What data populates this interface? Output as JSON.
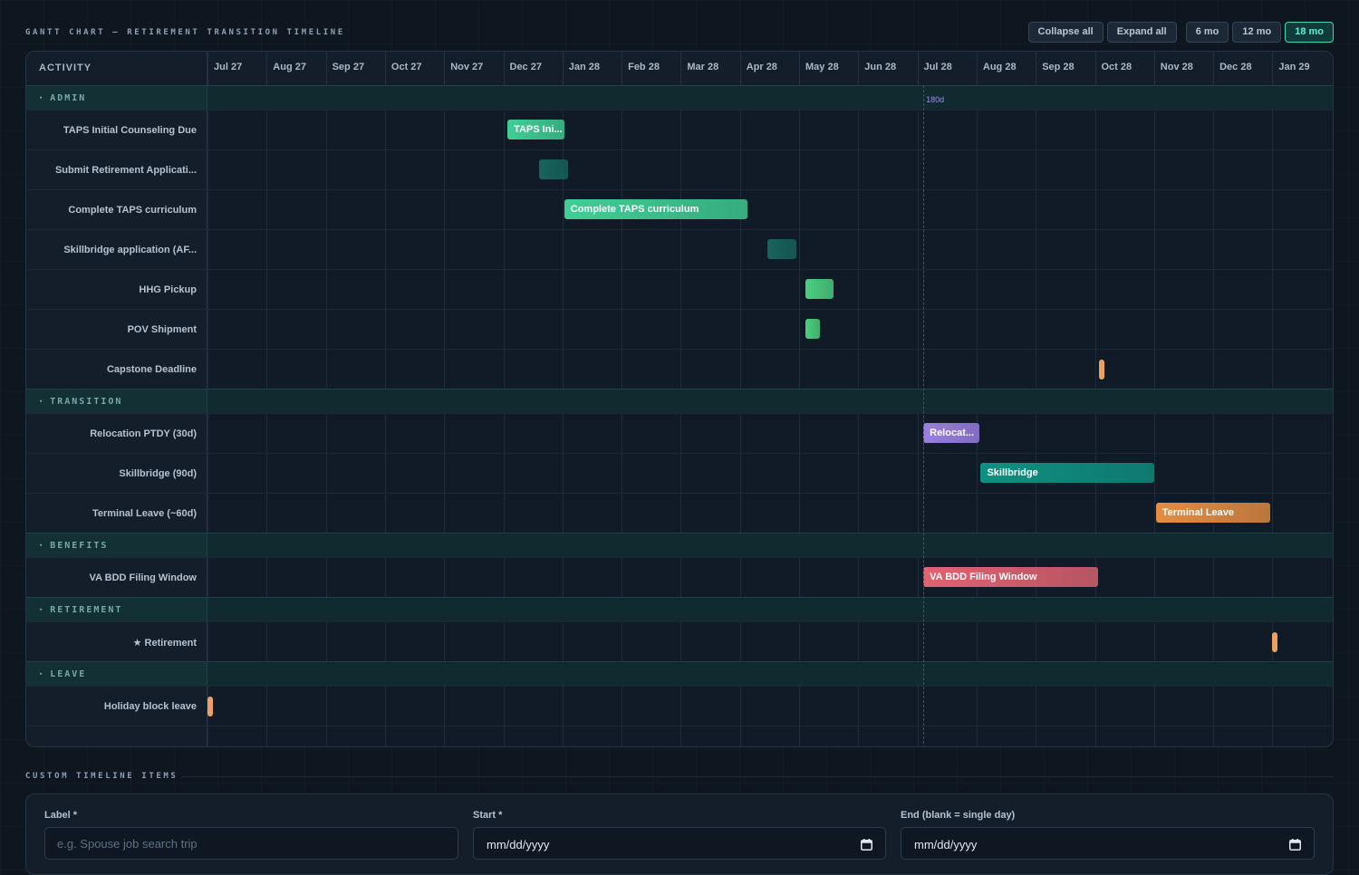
{
  "header": {
    "title": "GANTT CHART — RETIREMENT TRANSITION TIMELINE",
    "buttons": {
      "collapse_all": "Collapse all",
      "expand_all": "Expand all",
      "range_6": "6 mo",
      "range_12": "12 mo",
      "range_18": "18 mo"
    },
    "active_range": "18 mo"
  },
  "gantt": {
    "activity_header": "ACTIVITY",
    "months": [
      "Jul 27",
      "Aug 27",
      "Sep 27",
      "Oct 27",
      "Nov 27",
      "Dec 27",
      "Jan 28",
      "Feb 28",
      "Mar 28",
      "Apr 28",
      "May 28",
      "Jun 28",
      "Jul 28",
      "Aug 28",
      "Sep 28",
      "Oct 28",
      "Nov 28",
      "Dec 28",
      "Jan 29"
    ],
    "today_marker_label": "180d",
    "sections": [
      {
        "name": "ADMIN",
        "tasks": [
          {
            "label": "TAPS Initial Counseling Due",
            "bar_label": "TAPS Ini...",
            "start_month": 5.07,
            "end_month": 6.03,
            "color": "#3fcf95",
            "kind": "bar"
          },
          {
            "label": "Submit Retirement Applicati...",
            "bar_label": "",
            "start_month": 5.61,
            "end_month": 6.1,
            "color": "#17635c",
            "kind": "bar"
          },
          {
            "label": "Complete TAPS curriculum",
            "bar_label": "Complete TAPS curriculum",
            "start_month": 6.03,
            "end_month": 9.13,
            "color": "#3fcf95",
            "kind": "bar"
          },
          {
            "label": "Skillbridge application (AF...",
            "bar_label": "",
            "start_month": 9.47,
            "end_month": 9.95,
            "color": "#17635c",
            "kind": "bar"
          },
          {
            "label": "HHG Pickup",
            "bar_label": "",
            "start_month": 10.1,
            "end_month": 10.58,
            "color": "#4cd07f",
            "kind": "bar"
          },
          {
            "label": "POV Shipment",
            "bar_label": "",
            "start_month": 10.1,
            "end_month": 10.35,
            "color": "#4cd07f",
            "kind": "bar"
          },
          {
            "label": "Capstone Deadline",
            "bar_label": "",
            "start_month": 15.1,
            "end_month": 15.1,
            "color": "#eba25f",
            "kind": "milestone"
          }
        ]
      },
      {
        "name": "TRANSITION",
        "tasks": [
          {
            "label": "Relocation PTDY (30d)",
            "bar_label": "Relocat...",
            "start_month": 12.1,
            "end_month": 13.05,
            "color": "#9b80e4",
            "kind": "bar"
          },
          {
            "label": "Skillbridge (90d)",
            "bar_label": "Skillbridge",
            "start_month": 13.07,
            "end_month": 16.0,
            "color": "#0f9080",
            "kind": "bar"
          },
          {
            "label": "Terminal Leave (~60d)",
            "bar_label": "Terminal Leave",
            "start_month": 16.03,
            "end_month": 17.96,
            "color": "#e58d42",
            "kind": "bar"
          }
        ]
      },
      {
        "name": "BENEFITS",
        "tasks": [
          {
            "label": "VA BDD Filing Window",
            "bar_label": "VA BDD Filing Window",
            "start_month": 12.1,
            "end_month": 15.05,
            "color": "#e06371",
            "kind": "bar"
          }
        ]
      },
      {
        "name": "RETIREMENT",
        "tasks": [
          {
            "label": "★ Retirement",
            "bar_label": "",
            "start_month": 18.03,
            "end_month": 18.03,
            "color": "#eba25f",
            "kind": "milestone"
          }
        ]
      },
      {
        "name": "LEAVE",
        "tasks": [
          {
            "label": "Holiday block leave",
            "bar_label": "",
            "start_month": 0.03,
            "end_month": 0.03,
            "color": "#eba25f",
            "kind": "milestone"
          }
        ]
      }
    ],
    "today_month": 12.1
  },
  "custom": {
    "title": "CUSTOM TIMELINE ITEMS",
    "label_field": {
      "label": "Label *",
      "placeholder": "e.g. Spouse job search trip"
    },
    "start_field": {
      "label": "Start *",
      "value": "mm/dd/yyyy"
    },
    "end_field": {
      "label": "End (blank = single day)",
      "value": "mm/dd/yyyy"
    }
  }
}
